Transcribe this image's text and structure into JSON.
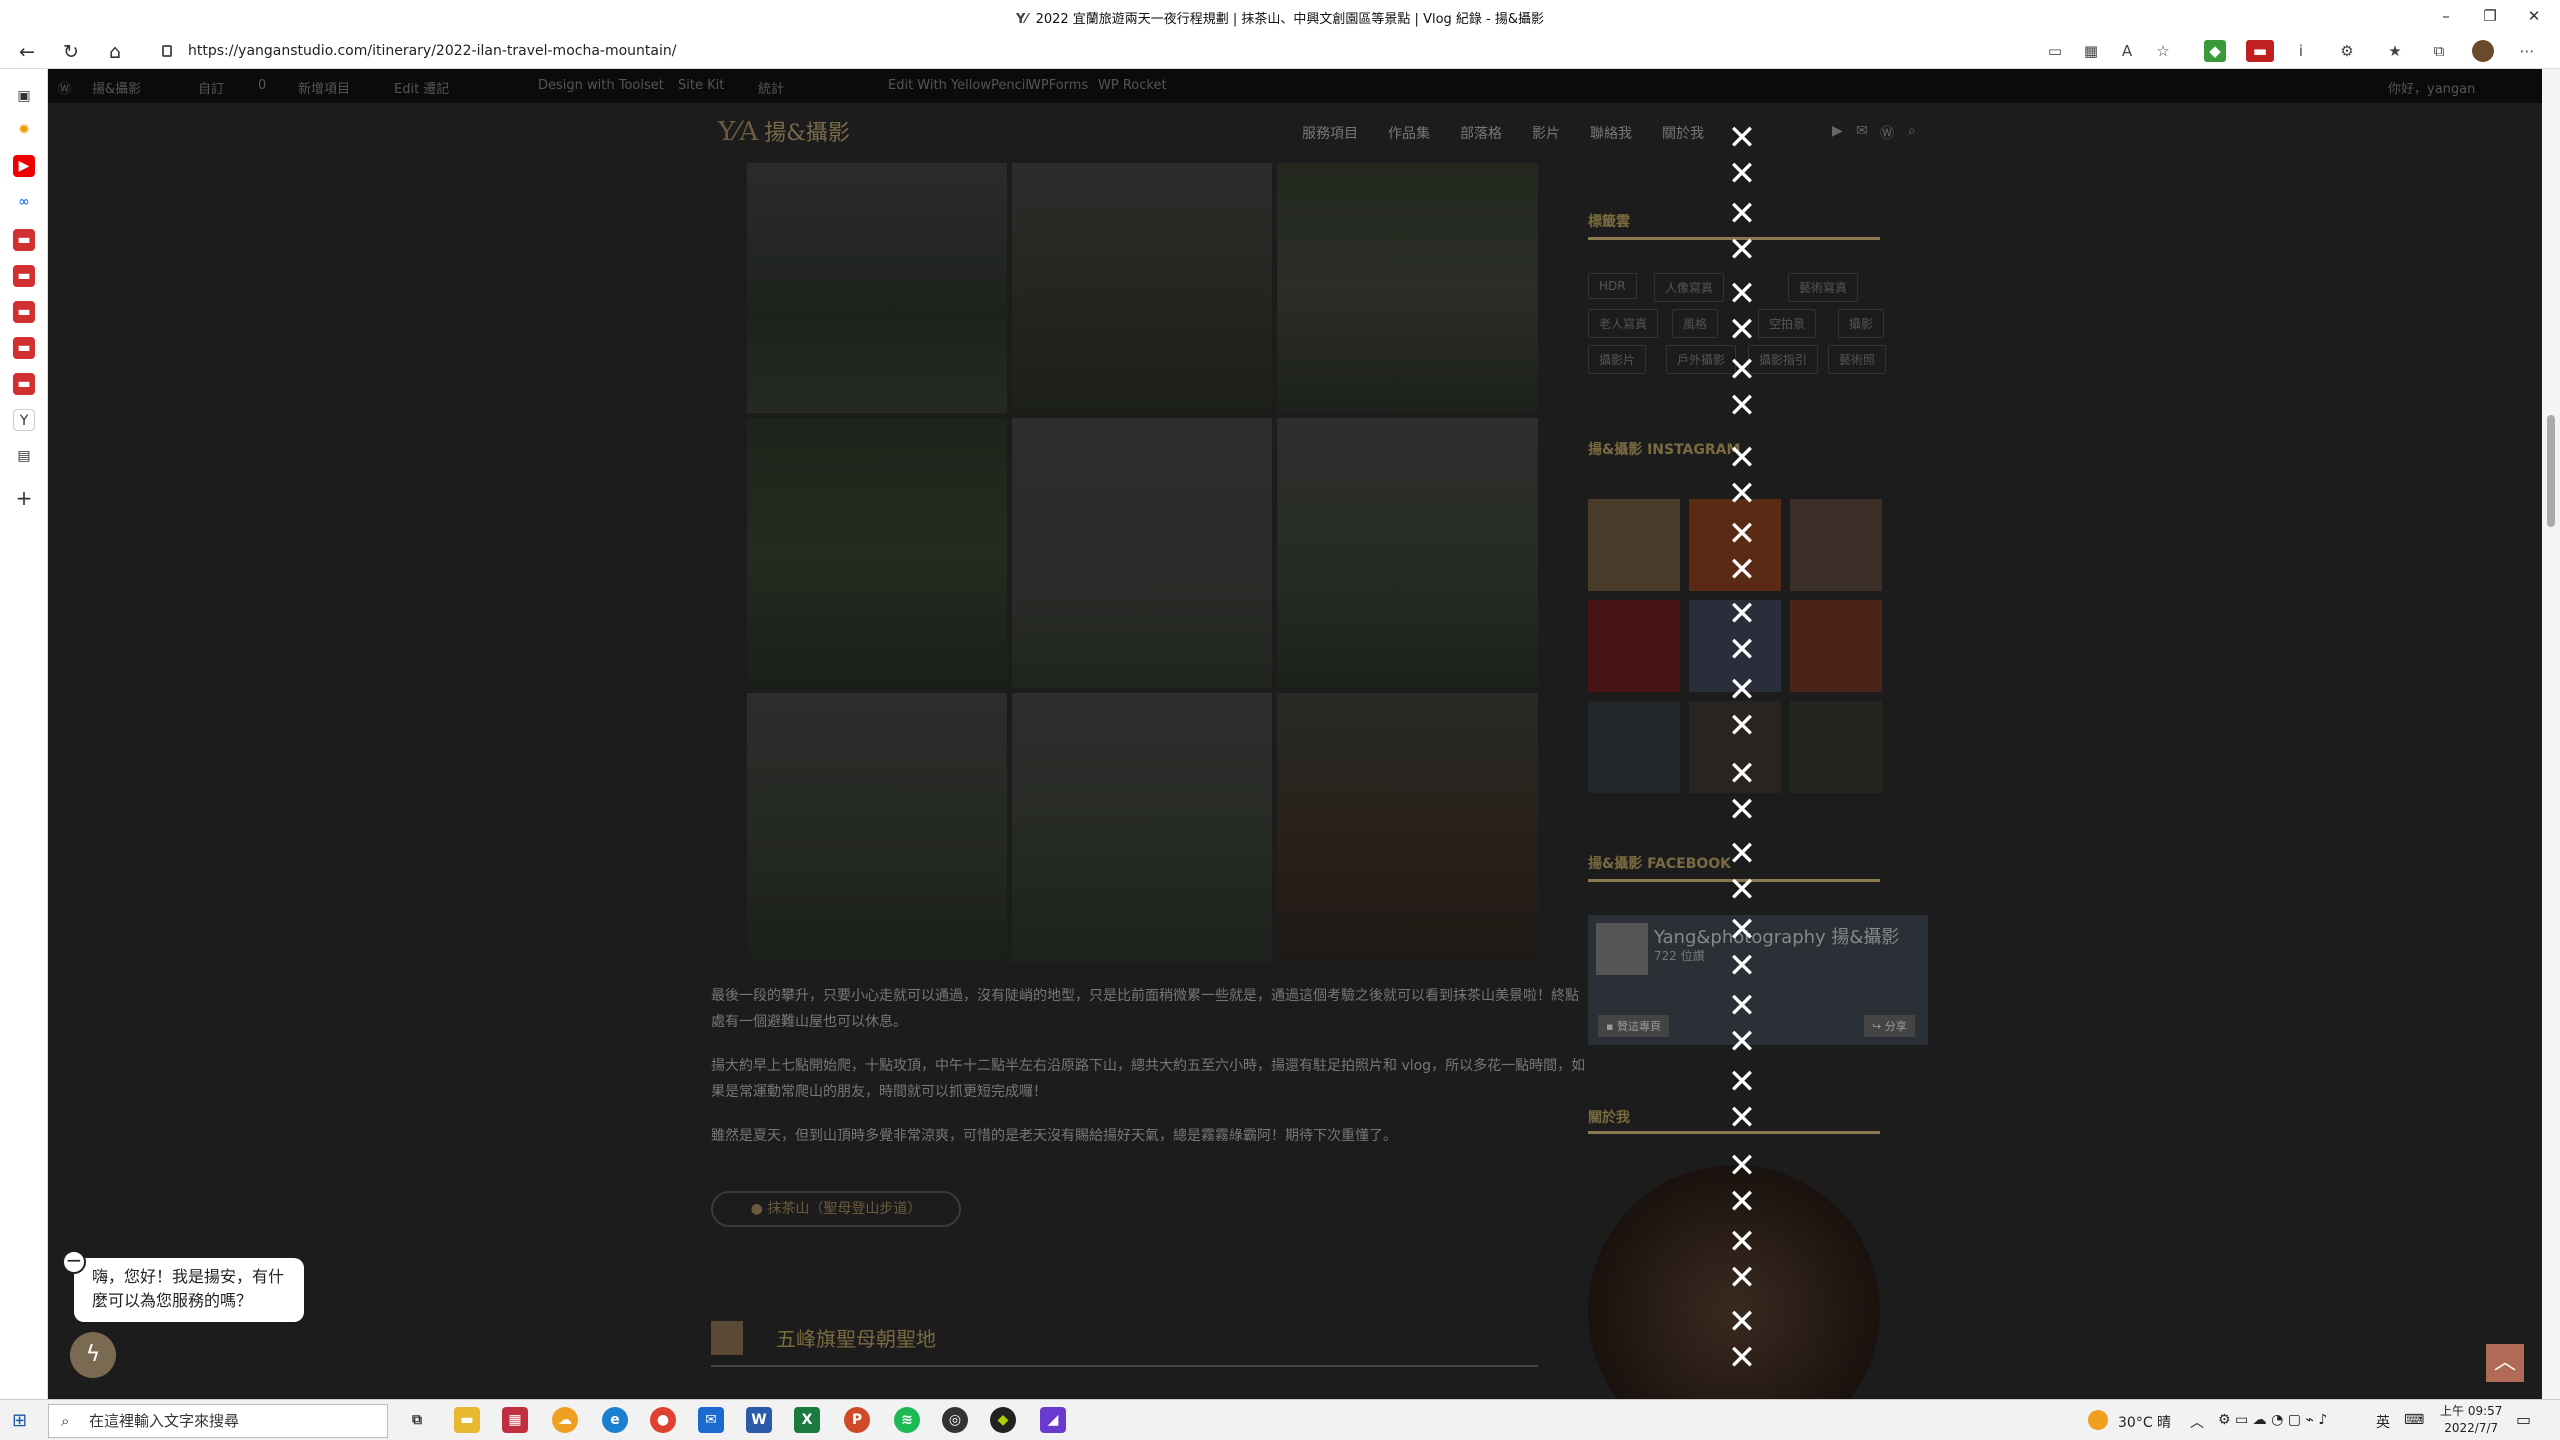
{
  "window": {
    "title": "2022 宜蘭旅遊兩天一夜行程規劃 | 抹茶山、中興文創園區等景點 | Vlog 紀錄 - 揚&攝影",
    "favicon_text": "Y⁄"
  },
  "browser": {
    "url": "https://yanganstudio.com/itinerary/2022-ilan-travel-mocha-mountain/"
  },
  "wpbar": {
    "items": [
      "揚&攝影",
      "自訂",
      "0",
      "新增項目",
      "Edit 遷記",
      "Design with Toolset",
      "Site Kit",
      "統計",
      "Edit With YellowPencil",
      "WPForms",
      "WP Rocket"
    ],
    "greeting": "你好，yangan"
  },
  "site": {
    "logo": "Y⁄A",
    "logo_text": "揚&攝影",
    "menu": [
      "服務項目",
      "作品集",
      "部落格",
      "影片",
      "聯絡我",
      "關於我"
    ]
  },
  "article": {
    "para1": "最後一段的攀升，只要小心走就可以通過，沒有陡峭的地型，只是比前面稍微累一些就是，通過這個考驗之後就可以看到抹茶山美景啦！終點處有一個避難山屋也可以休息。",
    "para2": "揚大約早上七點開始爬，十點攻頂，中午十二點半左右沿原路下山，總共大約五至六小時，揚還有駐足拍照片和 vlog，所以多花一點時間，如果是常運動常爬山的朋友，時間就可以抓更短完成囉！",
    "para3": "雖然是夏天，但到山頂時多覺非常涼爽，可惜的是老天沒有賜給揚好天氣，總是霧霧綠霸阿！期待下次重懂了。",
    "tag_button": "抹茶山（聖母登山步道）",
    "section_title": "五峰旗聖母朝聖地"
  },
  "widgets": {
    "tags_title": "標籤雲",
    "tags": [
      "HDR",
      "人像寫真",
      "",
      "藝術寫真",
      "老人寫真",
      "風格",
      "空拍景",
      "攝影",
      "攝影片",
      "戶外攝影",
      "攝影指引",
      "藝術照"
    ],
    "instagram_title": "揚&攝影 INSTAGRAM",
    "facebook_title": "揚&攝影 FACEBOOK",
    "fb_page_name": "Yang&photography 揚&攝影",
    "fb_followers": "722 位讚",
    "fb_like": "贊這專頁",
    "fb_share": "分享",
    "about_title": "關於我"
  },
  "overlay": {
    "close_glyph": "✕"
  },
  "chat": {
    "message": "嗨，您好！我是揚安，有什麼可以為您服務的嗎？",
    "close": "−"
  },
  "taskbar": {
    "search_placeholder": "在這裡輸入文字來搜尋",
    "weather": "30°C 晴",
    "ime": "英",
    "time": "上午 09:57",
    "date": "2022/7/7"
  }
}
